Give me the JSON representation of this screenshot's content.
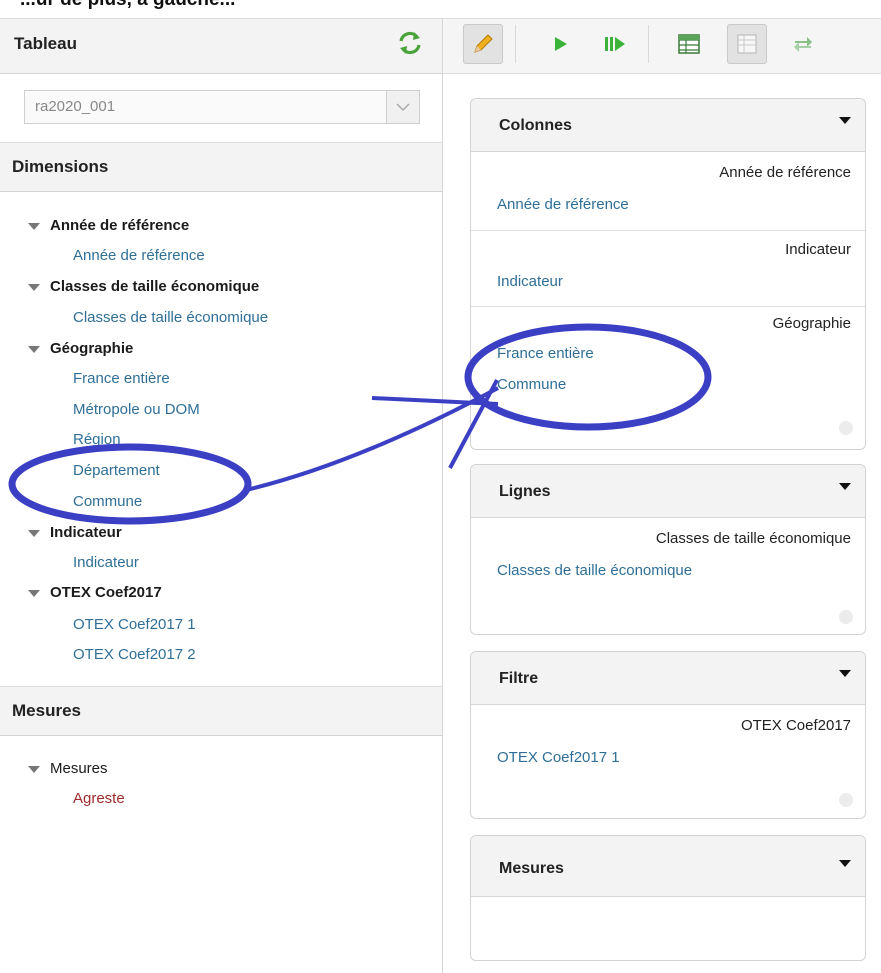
{
  "top_cut_text": "...ur de plus, a gauche...",
  "left": {
    "tableau_label": "Tableau",
    "cube_select_value": "ra2020_001",
    "dimensions_label": "Dimensions",
    "dimension_groups": [
      {
        "label": "Année de référence",
        "members": [
          "Année de référence"
        ]
      },
      {
        "label": "Classes de taille économique",
        "members": [
          "Classes de taille économique"
        ]
      },
      {
        "label": "Géographie",
        "members": [
          "France entière",
          "Métropole ou DOM",
          "Région",
          "Département",
          "Commune"
        ]
      },
      {
        "label": "Indicateur",
        "members": [
          "Indicateur"
        ]
      },
      {
        "label": "OTEX Coef2017",
        "members": [
          "OTEX Coef2017 1",
          "OTEX Coef2017 2"
        ]
      }
    ],
    "mesures_label": "Mesures",
    "mesures_group": "Mesures",
    "mesures_member": "Agreste"
  },
  "toolbar": {
    "icons": [
      "pencil-icon",
      "play-icon",
      "fast-forward-icon",
      "table-icon",
      "spreadsheet-icon",
      "swap-icon"
    ]
  },
  "zones": {
    "colonnes": {
      "title": "Colonnes",
      "items": [
        {
          "dimension": "Année de référence",
          "members": [
            "Année de référence"
          ]
        },
        {
          "dimension": "Indicateur",
          "members": [
            "Indicateur"
          ]
        },
        {
          "dimension": "Géographie",
          "members": [
            "France entière",
            "Commune"
          ]
        }
      ]
    },
    "lignes": {
      "title": "Lignes",
      "items": [
        {
          "dimension": "Classes de taille économique",
          "members": [
            "Classes de taille économique"
          ]
        }
      ]
    },
    "filtre": {
      "title": "Filtre",
      "items": [
        {
          "dimension": "OTEX Coef2017",
          "members": [
            "OTEX Coef2017 1"
          ]
        }
      ]
    },
    "mesures": {
      "title": "Mesures"
    }
  },
  "colors": {
    "link": "#2f6f97",
    "measure": "#9e2b2b",
    "annotation": "#3b3fc4",
    "refresh": "#4aa33a"
  }
}
